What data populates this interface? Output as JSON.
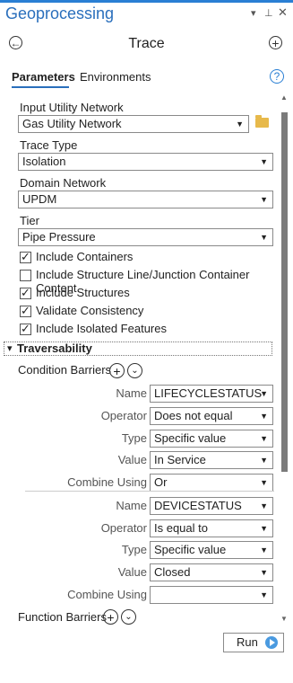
{
  "window": {
    "title": "Geoprocessing",
    "pin_icon": "pin-icon",
    "close_icon": "close-icon",
    "menu_icon": "chevron-down-icon"
  },
  "tool": {
    "title": "Trace"
  },
  "tabs": [
    {
      "label": "Parameters"
    },
    {
      "label": "Environments"
    }
  ],
  "params": {
    "input_network_label": "Input Utility Network",
    "input_network_value": "Gas Utility Network",
    "trace_type_label": "Trace Type",
    "trace_type_value": "Isolation",
    "domain_label": "Domain Network",
    "domain_value": "UPDM",
    "tier_label": "Tier",
    "tier_value": "Pipe Pressure"
  },
  "checkboxes": [
    {
      "label": "Include Containers",
      "checked": true
    },
    {
      "label": "Include Structure Line/Junction Container Content",
      "checked": false
    },
    {
      "label": "Include Structures",
      "checked": true
    },
    {
      "label": "Validate Consistency",
      "checked": true
    },
    {
      "label": "Include Isolated Features",
      "checked": true
    }
  ],
  "traversability": {
    "section_label": "Traversability",
    "condition_barriers_label": "Condition Barriers",
    "field_labels": {
      "name": "Name",
      "operator": "Operator",
      "type": "Type",
      "value": "Value",
      "combine": "Combine Using"
    },
    "barrier1": {
      "name": "LIFECYCLESTATUS",
      "operator": "Does not equal",
      "type": "Specific value",
      "value": "In Service",
      "combine": "Or"
    },
    "barrier2": {
      "name": "DEVICESTATUS",
      "operator": "Is equal to",
      "type": "Specific value",
      "value": "Closed",
      "combine": ""
    },
    "function_barriers_label": "Function Barriers"
  },
  "run": {
    "label": "Run"
  },
  "colors": {
    "accent": "#2a6fbc",
    "run_icon": "#4a9ae0",
    "folder": "#e7b94b"
  }
}
